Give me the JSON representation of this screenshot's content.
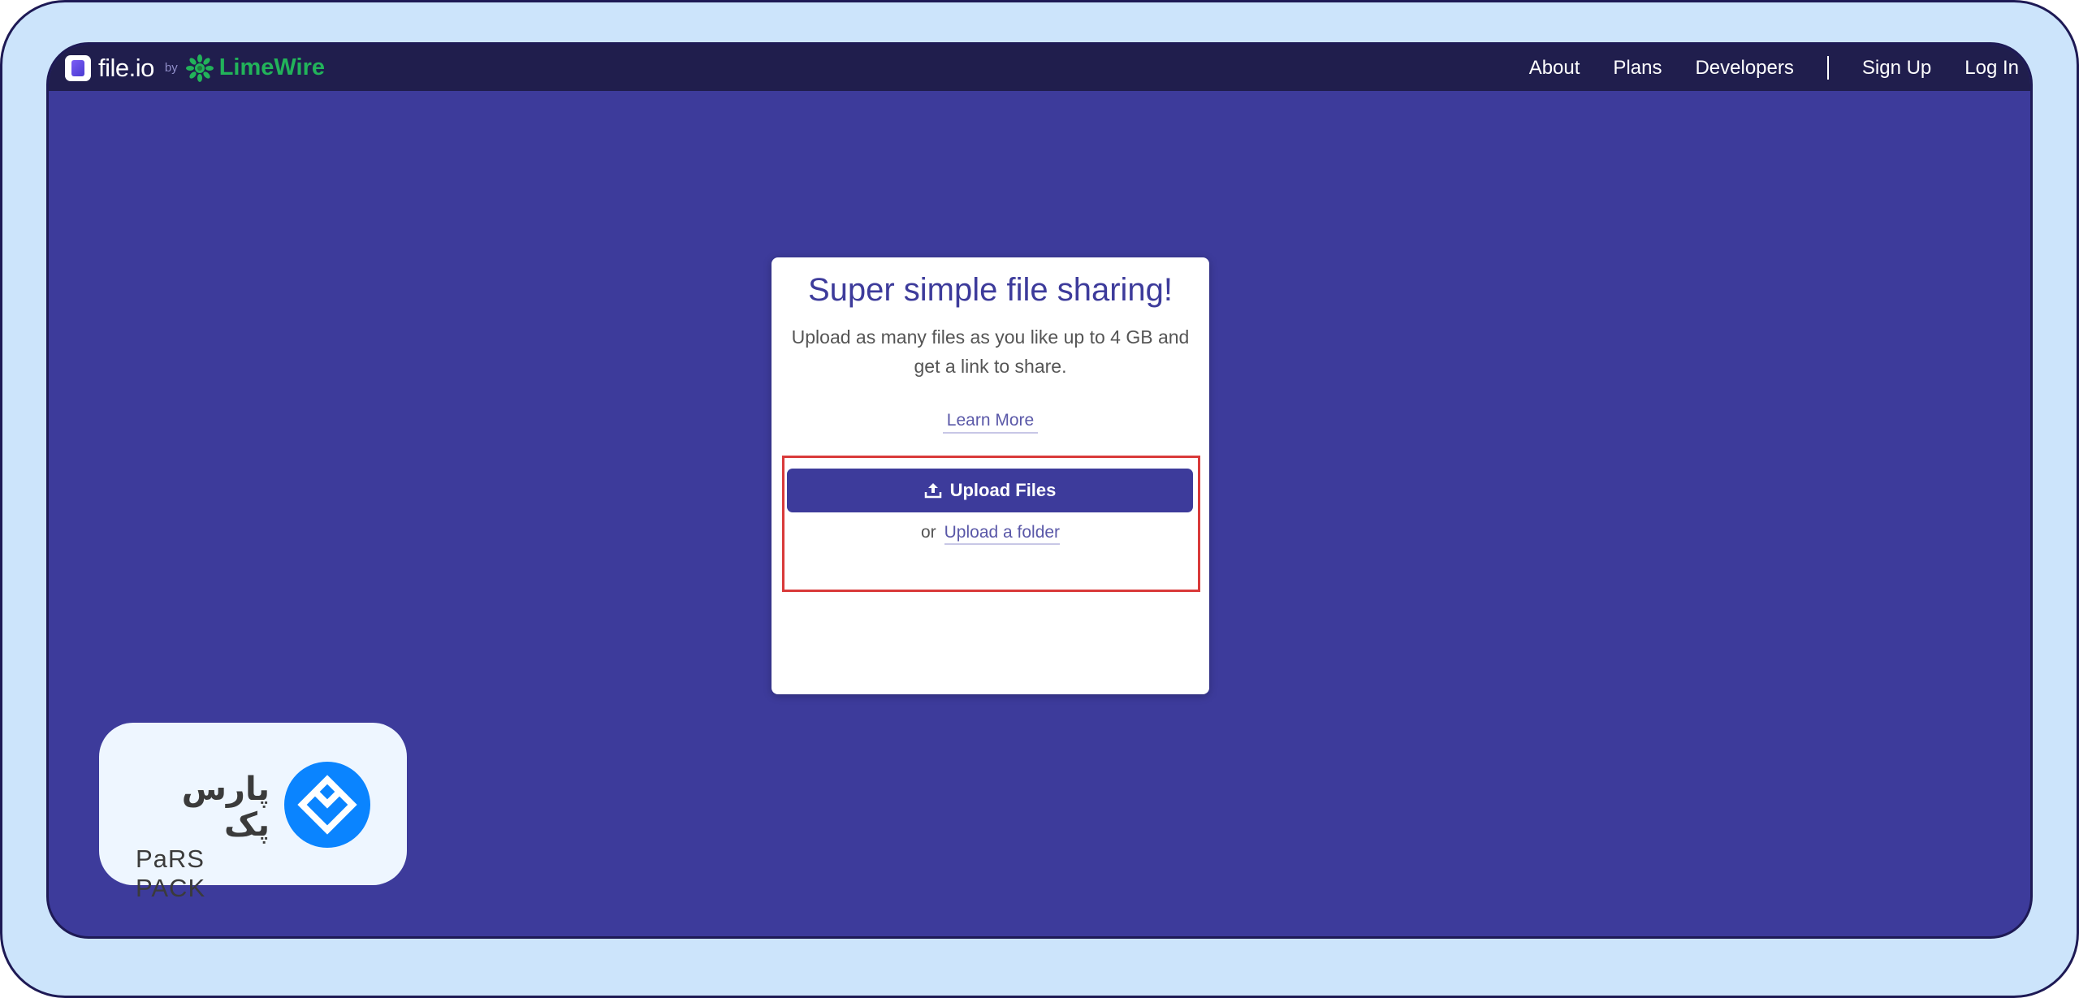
{
  "navbar": {
    "brand_name": "file.io",
    "by_text": "by",
    "partner_name": "LimeWire",
    "links": [
      {
        "label": "About"
      },
      {
        "label": "Plans"
      },
      {
        "label": "Developers"
      },
      {
        "label": "Sign Up"
      },
      {
        "label": "Log In"
      }
    ]
  },
  "card": {
    "title": "Super simple file sharing!",
    "subtitle": "Upload as many files as you like up to 4 GB and get a link to share.",
    "learn_more": "Learn More",
    "upload_button_label": "Upload Files",
    "or_text": "or",
    "upload_folder_link": "Upload a folder"
  },
  "watermark": {
    "persian_text": "پارس پک",
    "latin_text": "PaRS PACK"
  },
  "colors": {
    "page_background": "#3d3b9b",
    "navbar_background": "#201e4d",
    "brand_accent": "#3d3b9b",
    "limewire_green": "#22b35a",
    "highlight_border": "#d93a3a",
    "frame_background": "#cce4fb",
    "parspack_blue": "#0a84ff"
  },
  "icons": {
    "brand": "fileio-logo-icon",
    "partner": "limewire-logo-icon",
    "upload": "upload-icon",
    "watermark": "parspack-logo-icon"
  }
}
